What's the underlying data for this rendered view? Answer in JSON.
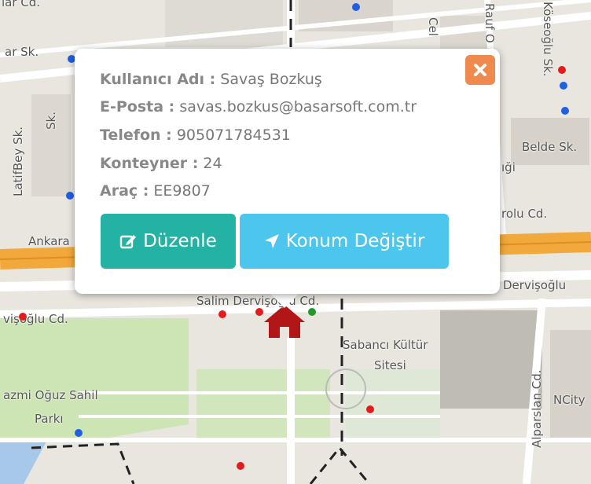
{
  "map": {
    "streets": {
      "top_left": "lar Cd.",
      "ar_sk": "ar Sk.",
      "latif_bey": "LatifBey Sk.",
      "sk_left": "Sk.",
      "cel": "Cel",
      "rauf": "Rauf O",
      "kosegil": "Köseoğlu Sk.",
      "belde": "Belde Sk.",
      "olu_cd": "rolu Cd.",
      "ankara": "Ankara",
      "salim": "Salim Dervişoğlu Cd.",
      "dervisoglu_right": "Dervişoğlu",
      "left_cd": "vişoğlu Cd.",
      "sabanci": "Sabancı Kültür",
      "sitesi": "Sitesi",
      "oguz_sahil": "azmi Oğuz Sahil",
      "parki": "Parkı",
      "alparslan": "Alparslan Cd.",
      "ncity": "NCity",
      "igi": "ıği"
    },
    "colors": {
      "land": "#e9e6e0",
      "park": "#cde4b4",
      "main_road": "#f2a93b",
      "road": "#ffffff",
      "building": "#d3cfc7",
      "house": "#b31616"
    }
  },
  "popup": {
    "fields": [
      {
        "label": "Kullanıcı Adı :",
        "value": "Savaş Bozkuş"
      },
      {
        "label": "E-Posta :",
        "value": "savas.bozkus@basarsoft.com.tr"
      },
      {
        "label": "Telefon :",
        "value": "905071784531"
      },
      {
        "label": "Konteyner :",
        "value": "24"
      },
      {
        "label": "Araç :",
        "value": "EE9807"
      }
    ],
    "buttons": {
      "edit": "Düzenle",
      "move": "Konum Değiştir"
    },
    "colors": {
      "edit_button": "#24b2a4",
      "move_button": "#4dc6ee",
      "close_button": "#f0894e"
    }
  }
}
